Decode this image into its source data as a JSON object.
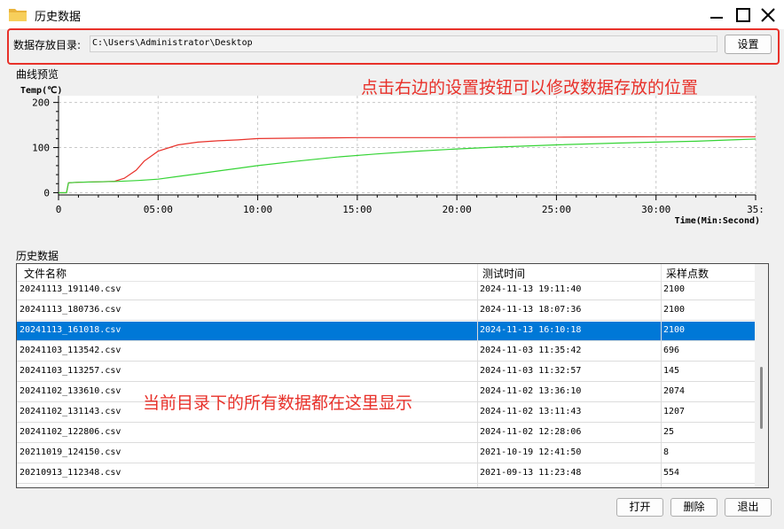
{
  "window": {
    "title": "历史数据",
    "icon": "folder-icon"
  },
  "directory": {
    "label": "数据存放目录:",
    "value": "C:\\Users\\Administrator\\Desktop",
    "settings_button": "设置"
  },
  "preview": {
    "label": "曲线预览"
  },
  "annotations": {
    "top": "点击右边的设置按钮可以修改数据存放的位置",
    "middle": "当前目录下的所有数据都在这里显示"
  },
  "history": {
    "label": "历史数据",
    "columns": [
      "文件名称",
      "测试时间",
      "采样点数"
    ],
    "rows": [
      {
        "name": "20241113_191140.csv",
        "time": "2024-11-13 19:11:40",
        "points": "2100"
      },
      {
        "name": "20241113_180736.csv",
        "time": "2024-11-13 18:07:36",
        "points": "2100"
      },
      {
        "name": "20241113_161018.csv",
        "time": "2024-11-13 16:10:18",
        "points": "2100",
        "selected": true
      },
      {
        "name": "20241103_113542.csv",
        "time": "2024-11-03 11:35:42",
        "points": "696"
      },
      {
        "name": "20241103_113257.csv",
        "time": "2024-11-03 11:32:57",
        "points": "145"
      },
      {
        "name": "20241102_133610.csv",
        "time": "2024-11-02 13:36:10",
        "points": "2074"
      },
      {
        "name": "20241102_131143.csv",
        "time": "2024-11-02 13:11:43",
        "points": "1207"
      },
      {
        "name": "20241102_122806.csv",
        "time": "2024-11-02 12:28:06",
        "points": "25"
      },
      {
        "name": "20211019_124150.csv",
        "time": "2021-10-19 12:41:50",
        "points": "8"
      },
      {
        "name": "20210913_112348.csv",
        "time": "2021-09-13 11:23:48",
        "points": "554"
      }
    ]
  },
  "buttons": {
    "open": "打开",
    "delete": "删除",
    "exit": "退出"
  },
  "chart_data": {
    "type": "line",
    "ylabel": "Temp(℃)",
    "xlabel": "Time(Min:Second)",
    "xlim": [
      0,
      35
    ],
    "ylim": [
      -5,
      215
    ],
    "x_ticks": [
      0,
      5,
      10,
      15,
      20,
      25,
      30,
      35
    ],
    "x_tick_labels": [
      "0",
      "05:00",
      "10:00",
      "15:00",
      "20:00",
      "25:00",
      "30:00",
      "35:"
    ],
    "y_ticks": [
      0,
      100,
      200
    ],
    "y_tick_labels": [
      "0",
      "100",
      "200"
    ],
    "grid": true,
    "series": [
      {
        "color": "#e8312a",
        "x": [
          0,
          0.4,
          0.5,
          1,
          2,
          2.8,
          3.3,
          3.9,
          4.3,
          5,
          6,
          7,
          8,
          9,
          10,
          12,
          15,
          20,
          25,
          30,
          35
        ],
        "y": [
          0,
          0,
          22,
          23,
          24,
          25,
          32,
          50,
          70,
          92,
          106,
          112,
          115,
          117,
          120,
          121,
          122,
          122,
          123,
          124,
          124
        ]
      },
      {
        "color": "#35d435",
        "x": [
          0,
          0.4,
          0.5,
          1,
          2,
          3,
          4,
          5,
          6,
          7,
          8,
          9,
          10,
          12,
          14,
          16,
          18,
          20,
          22,
          25,
          28,
          30,
          32,
          35
        ],
        "y": [
          0,
          0,
          22,
          23,
          24,
          25,
          27,
          30,
          36,
          42,
          48,
          54,
          60,
          70,
          79,
          86,
          92,
          97,
          101,
          106,
          110,
          112,
          114,
          119
        ]
      }
    ]
  }
}
